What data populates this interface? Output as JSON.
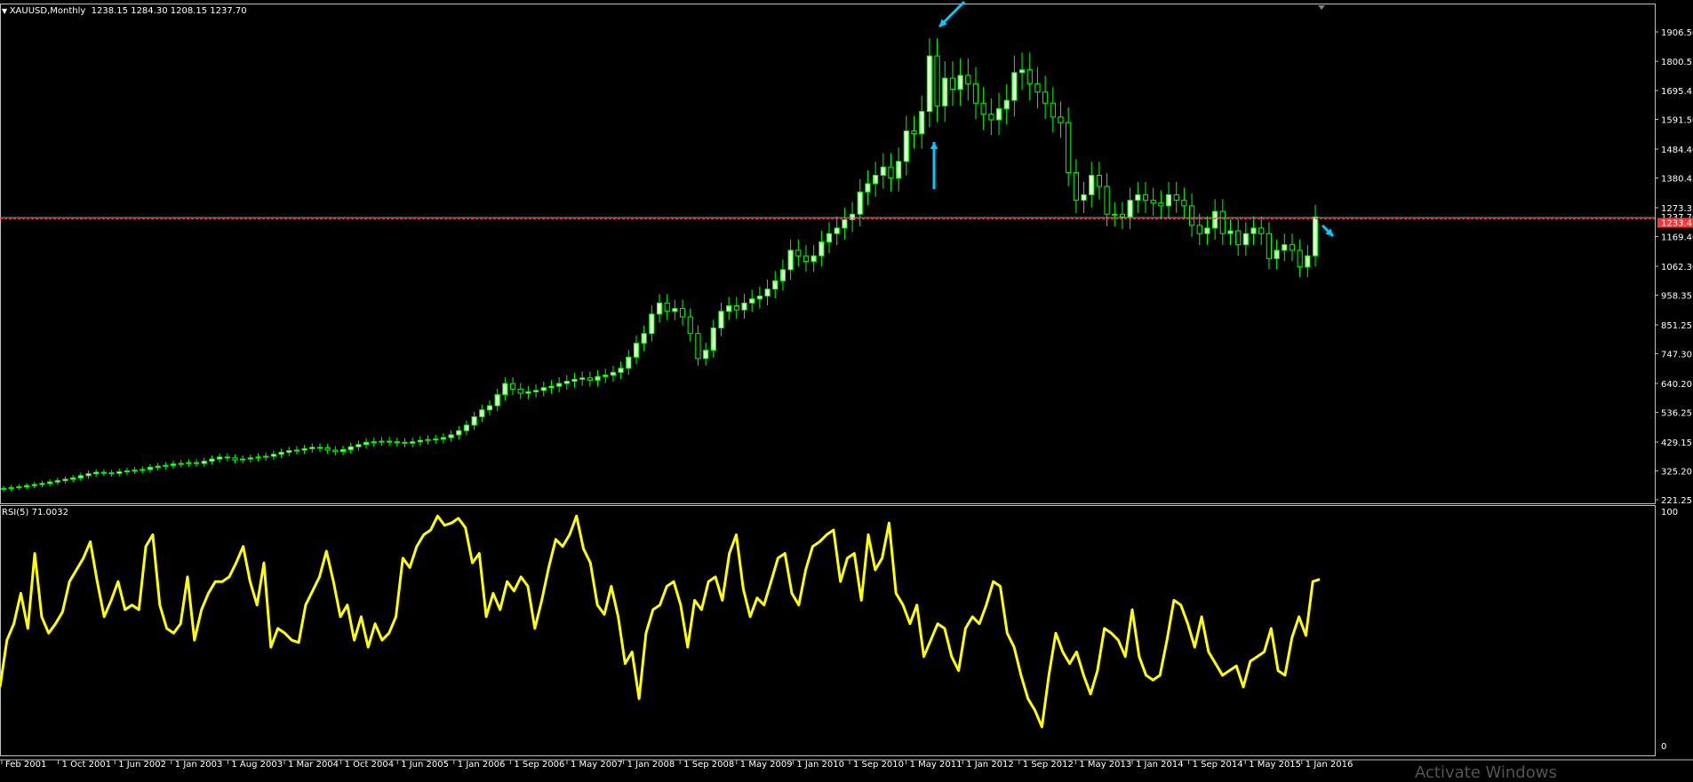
{
  "window": {
    "symbol_header": "XAUUSD,Monthly",
    "ohlc_header": "1238.15 1284.30 1208.15 1237.70",
    "rsi_header": "RSI(5) 71.0032",
    "watermark": "Activate Windows"
  },
  "colors": {
    "background": "#000000",
    "axis": "#c0c0c0",
    "bull": "#00ff00",
    "bull_fill": "#d9ffcc",
    "bear": "#00ff00",
    "bear_fill": "#000000",
    "rsi_line": "#ffff00",
    "bid_line": "#a0a0a0",
    "ask_line": "#ff3333",
    "price_badge": "#ff3333",
    "arrow": "#00ccff"
  },
  "chart_data": [
    {
      "type": "candlestick",
      "title": "XAUUSD,Monthly",
      "price_scale": [
        "1906.50",
        "1800.55",
        "1695.45",
        "1591.50",
        "1484.40",
        "1380.45",
        "1273.35",
        "1169.40",
        "1062.30",
        "958.35",
        "851.25",
        "747.30",
        "640.20",
        "536.25",
        "429.15",
        "325.20",
        "221.25"
      ],
      "current_price_labels": [
        "1237.70",
        "1233.41"
      ],
      "ylim": [
        221.25,
        1906.5
      ],
      "time_labels": [
        "Feb 2001",
        "1 Oct 2001",
        "1 Jun 2002",
        "1 Jan 2003",
        "1 Aug 2003",
        "1 Mar 2004",
        "1 Oct 2004",
        "1 Jun 2005",
        "1 Jan 2006",
        "1 Sep 2006",
        "1 May 2007",
        "1 Jan 2008",
        "1 Sep 2008",
        "1 May 2009",
        "1 Jan 2010",
        "1 Sep 2010",
        "1 May 2011",
        "1 Jan 2012",
        "1 Sep 2012",
        "1 May 2013",
        "1 Jan 2014",
        "1 Sep 2014",
        "1 May 2015",
        "1 Jan 2016"
      ],
      "closes": [
        262,
        265,
        268,
        272,
        276,
        280,
        285,
        290,
        295,
        300,
        308,
        315,
        320,
        318,
        316,
        322,
        325,
        328,
        330,
        338,
        342,
        345,
        350,
        352,
        355,
        352,
        360,
        368,
        375,
        372,
        365,
        368,
        372,
        375,
        378,
        385,
        392,
        398,
        400,
        405,
        410,
        408,
        400,
        395,
        402,
        412,
        420,
        428,
        430,
        432,
        430,
        428,
        425,
        430,
        435,
        438,
        440,
        445,
        455,
        470,
        490,
        520,
        545,
        560,
        600,
        640,
        620,
        605,
        610,
        615,
        625,
        630,
        640,
        648,
        655,
        660,
        652,
        665,
        670,
        680,
        695,
        735,
        785,
        820,
        890,
        930,
        900,
        910,
        880,
        820,
        730,
        760,
        840,
        900,
        920,
        905,
        930,
        945,
        955,
        980,
        1010,
        1050,
        1120,
        1100,
        1080,
        1100,
        1150,
        1180,
        1200,
        1230,
        1250,
        1330,
        1360,
        1390,
        1420,
        1380,
        1440,
        1550,
        1540,
        1620,
        1820,
        1640,
        1740,
        1700,
        1750,
        1720,
        1650,
        1610,
        1590,
        1630,
        1660,
        1760,
        1770,
        1720,
        1690,
        1650,
        1600,
        1580,
        1400,
        1300,
        1320,
        1390,
        1350,
        1250,
        1250,
        1240,
        1300,
        1320,
        1300,
        1290,
        1280,
        1320,
        1300,
        1280,
        1210,
        1180,
        1200,
        1260,
        1180,
        1190,
        1140,
        1180,
        1200,
        1180,
        1090,
        1120,
        1140,
        1120,
        1060,
        1100,
        1240
      ]
    },
    {
      "type": "line",
      "title": "RSI(5) 71.0032",
      "ylim": [
        0,
        100
      ],
      "scale_labels": [
        "100",
        "0"
      ],
      "values": [
        25,
        45,
        52,
        65,
        50,
        82,
        55,
        48,
        52,
        57,
        70,
        75,
        80,
        87,
        70,
        55,
        62,
        70,
        58,
        60,
        58,
        85,
        90,
        60,
        50,
        48,
        52,
        72,
        45,
        58,
        65,
        70,
        70,
        72,
        78,
        85,
        70,
        60,
        78,
        42,
        50,
        48,
        45,
        44,
        60,
        66,
        72,
        83,
        70,
        55,
        60,
        45,
        55,
        42,
        52,
        45,
        48,
        55,
        80,
        76,
        85,
        90,
        92,
        98,
        94,
        95,
        97,
        93,
        78,
        82,
        55,
        65,
        58,
        70,
        66,
        72,
        68,
        50,
        62,
        76,
        88,
        85,
        90,
        98,
        84,
        78,
        60,
        56,
        68,
        55,
        35,
        40,
        20,
        48,
        58,
        60,
        68,
        70,
        60,
        42,
        62,
        58,
        70,
        72,
        62,
        82,
        90,
        67,
        55,
        63,
        60,
        70,
        80,
        82,
        65,
        60,
        75,
        85,
        87,
        90,
        92,
        70,
        80,
        82,
        62,
        90,
        75,
        80,
        95,
        65,
        60,
        52,
        60,
        38,
        45,
        52,
        50,
        38,
        32,
        50,
        55,
        52,
        60,
        70,
        68,
        48,
        42,
        30,
        20,
        15,
        8,
        30,
        48,
        40,
        35,
        40,
        30,
        22,
        32,
        50,
        48,
        45,
        38,
        58,
        38,
        30,
        28,
        30,
        45,
        62,
        60,
        52,
        42,
        55,
        40,
        35,
        30,
        32,
        34,
        25,
        36,
        38,
        40,
        50,
        32,
        30,
        46,
        55,
        47,
        70,
        71
      ]
    }
  ]
}
